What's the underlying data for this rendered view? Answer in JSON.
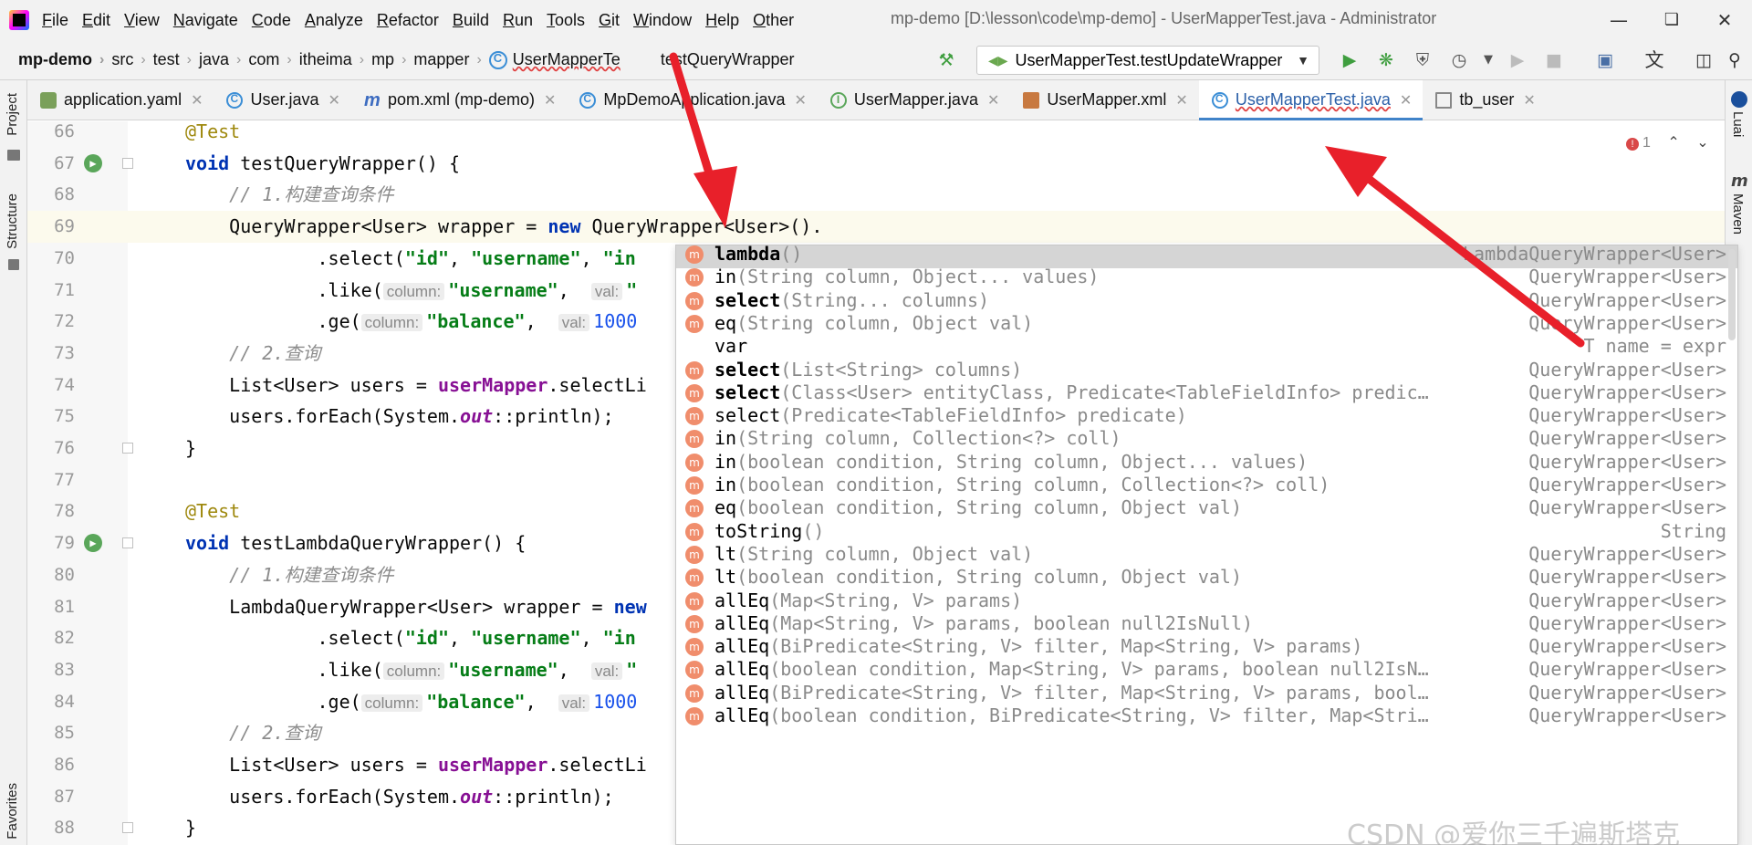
{
  "menu": {
    "items": [
      "File",
      "Edit",
      "View",
      "Navigate",
      "Code",
      "Analyze",
      "Refactor",
      "Build",
      "Run",
      "Tools",
      "Git",
      "Window",
      "Help",
      "Other"
    ],
    "title": "mp-demo [D:\\lesson\\code\\mp-demo] - UserMapperTest.java - Administrator"
  },
  "nav": {
    "crumbs": [
      "mp-demo",
      "src",
      "test",
      "java",
      "com",
      "itheima",
      "mp",
      "mapper",
      "UserMapperTe",
      "testQueryWrapper"
    ],
    "run_config": "UserMapperTest.testUpdateWrapper"
  },
  "tabs": [
    {
      "label": "application.yaml",
      "icon": "yaml-icon"
    },
    {
      "label": "User.java",
      "icon": "class-icon"
    },
    {
      "label": "pom.xml (mp-demo)",
      "icon": "maven-icon"
    },
    {
      "label": "MpDemoApplication.java",
      "icon": "class-icon"
    },
    {
      "label": "UserMapper.java",
      "icon": "interface-icon"
    },
    {
      "label": "UserMapper.xml",
      "icon": "xml-icon"
    },
    {
      "label": "UserMapperTest.java",
      "icon": "class-icon",
      "active": true
    },
    {
      "label": "tb_user",
      "icon": "table-icon"
    }
  ],
  "side": {
    "project": "Project",
    "structure": "Structure",
    "favorites": "Favorites",
    "right_top": "Luai",
    "maven": "Maven"
  },
  "editor": {
    "error_count": "1",
    "lines": [
      {
        "n": "66",
        "parts": [
          [
            "ann",
            "@Test"
          ]
        ]
      },
      {
        "n": "67",
        "gutter": true,
        "parts": [
          [
            "kw",
            "void"
          ],
          [
            "",
            " testQueryWrapper() {"
          ]
        ]
      },
      {
        "n": "68",
        "parts": [
          [
            "cm",
            "    // 1.构建查询条件"
          ]
        ]
      },
      {
        "n": "69",
        "cur": true,
        "parts": [
          [
            "",
            "    QueryWrapper<User> wrapper = "
          ],
          [
            "kw",
            "new"
          ],
          [
            "",
            " QueryWrapper<User>()."
          ]
        ]
      },
      {
        "n": "70",
        "parts": [
          [
            "",
            "            .select("
          ],
          [
            "st",
            "\"id\""
          ],
          [
            "",
            ", "
          ],
          [
            "st",
            "\"username\""
          ],
          [
            "",
            ", "
          ],
          [
            "st",
            "\"in"
          ]
        ]
      },
      {
        "n": "71",
        "parts": [
          [
            "",
            "            .like("
          ],
          [
            "hint",
            "column:"
          ],
          [
            "st",
            "\"username\""
          ],
          [
            "",
            ",  "
          ],
          [
            "hint",
            "val:"
          ],
          [
            "st",
            "\""
          ]
        ]
      },
      {
        "n": "72",
        "parts": [
          [
            "",
            "            .ge("
          ],
          [
            "hint",
            "column:"
          ],
          [
            "st",
            "\"balance\""
          ],
          [
            "",
            ",  "
          ],
          [
            "hint",
            "val:"
          ],
          [
            "num",
            "1000"
          ]
        ]
      },
      {
        "n": "73",
        "parts": [
          [
            "cm",
            "    // 2.查询"
          ]
        ]
      },
      {
        "n": "74",
        "parts": [
          [
            "",
            "    List<User> users = "
          ],
          [
            "fld",
            "userMapper"
          ],
          [
            "",
            ".selectLi"
          ]
        ]
      },
      {
        "n": "75",
        "parts": [
          [
            "",
            "    users.forEach(System."
          ],
          [
            "st-i",
            "out"
          ],
          [
            "",
            "::println);"
          ]
        ]
      },
      {
        "n": "76",
        "parts": [
          [
            "",
            "}"
          ]
        ]
      },
      {
        "n": "77",
        "parts": [
          [
            "",
            ""
          ]
        ]
      },
      {
        "n": "78",
        "parts": [
          [
            "ann",
            "@Test"
          ]
        ]
      },
      {
        "n": "79",
        "gutter": true,
        "parts": [
          [
            "kw",
            "void"
          ],
          [
            "",
            " testLambdaQueryWrapper() {"
          ]
        ]
      },
      {
        "n": "80",
        "parts": [
          [
            "cm",
            "    // 1.构建查询条件"
          ]
        ]
      },
      {
        "n": "81",
        "parts": [
          [
            "",
            "    LambdaQueryWrapper<User> wrapper = "
          ],
          [
            "kw",
            "new"
          ]
        ]
      },
      {
        "n": "82",
        "parts": [
          [
            "",
            "            .select("
          ],
          [
            "st",
            "\"id\""
          ],
          [
            "",
            ", "
          ],
          [
            "st",
            "\"username\""
          ],
          [
            "",
            ", "
          ],
          [
            "st",
            "\"in"
          ]
        ]
      },
      {
        "n": "83",
        "parts": [
          [
            "",
            "            .like("
          ],
          [
            "hint",
            "column:"
          ],
          [
            "st",
            "\"username\""
          ],
          [
            "",
            ",  "
          ],
          [
            "hint",
            "val:"
          ],
          [
            "st",
            "\""
          ]
        ]
      },
      {
        "n": "84",
        "parts": [
          [
            "",
            "            .ge("
          ],
          [
            "hint",
            "column:"
          ],
          [
            "st",
            "\"balance\""
          ],
          [
            "",
            ",  "
          ],
          [
            "hint",
            "val:"
          ],
          [
            "num",
            "1000"
          ]
        ]
      },
      {
        "n": "85",
        "parts": [
          [
            "cm",
            "    // 2.查询"
          ]
        ]
      },
      {
        "n": "86",
        "parts": [
          [
            "",
            "    List<User> users = "
          ],
          [
            "fld",
            "userMapper"
          ],
          [
            "",
            ".selectLi"
          ]
        ]
      },
      {
        "n": "87",
        "parts": [
          [
            "",
            "    users.forEach(System."
          ],
          [
            "st-i",
            "out"
          ],
          [
            "",
            "::println);"
          ]
        ]
      },
      {
        "n": "88",
        "parts": [
          [
            "",
            "}"
          ]
        ]
      }
    ]
  },
  "completion": {
    "items": [
      {
        "name": "lambda",
        "sig": "()",
        "ret": "LambdaQueryWrapper<User>",
        "bold": true,
        "selected": true,
        "icon": true
      },
      {
        "name": "in",
        "sig": "(String column, Object... values)",
        "ret": "QueryWrapper<User>",
        "icon": true
      },
      {
        "name": "select",
        "sig": "(String... columns)",
        "ret": "QueryWrapper<User>",
        "bold": true,
        "icon": true
      },
      {
        "name": "eq",
        "sig": "(String column, Object val)",
        "ret": "QueryWrapper<User>",
        "icon": true
      },
      {
        "name": "var",
        "sig": "",
        "ret": "T name = expr",
        "icon": false
      },
      {
        "name": "select",
        "sig": "(List<String> columns)",
        "ret": "QueryWrapper<User>",
        "bold": true,
        "icon": true
      },
      {
        "name": "select",
        "sig": "(Class<User> entityClass, Predicate<TableFieldInfo> predic…",
        "ret": "QueryWrapper<User>",
        "bold": true,
        "icon": true
      },
      {
        "name": "select",
        "sig": "(Predicate<TableFieldInfo> predicate)",
        "ret": "QueryWrapper<User>",
        "icon": true
      },
      {
        "name": "in",
        "sig": "(String column, Collection<?> coll)",
        "ret": "QueryWrapper<User>",
        "icon": true
      },
      {
        "name": "in",
        "sig": "(boolean condition, String column, Object... values)",
        "ret": "QueryWrapper<User>",
        "icon": true
      },
      {
        "name": "in",
        "sig": "(boolean condition, String column, Collection<?> coll)",
        "ret": "QueryWrapper<User>",
        "icon": true
      },
      {
        "name": "eq",
        "sig": "(boolean condition, String column, Object val)",
        "ret": "QueryWrapper<User>",
        "icon": true
      },
      {
        "name": "toString",
        "sig": "()",
        "ret": "String",
        "icon": true
      },
      {
        "name": "lt",
        "sig": "(String column, Object val)",
        "ret": "QueryWrapper<User>",
        "icon": true
      },
      {
        "name": "lt",
        "sig": "(boolean condition, String column, Object val)",
        "ret": "QueryWrapper<User>",
        "icon": true
      },
      {
        "name": "allEq",
        "sig": "(Map<String, V> params)",
        "ret": "QueryWrapper<User>",
        "icon": true
      },
      {
        "name": "allEq",
        "sig": "(Map<String, V> params, boolean null2IsNull)",
        "ret": "QueryWrapper<User>",
        "icon": true
      },
      {
        "name": "allEq",
        "sig": "(BiPredicate<String, V> filter, Map<String, V> params)",
        "ret": "QueryWrapper<User>",
        "icon": true
      },
      {
        "name": "allEq",
        "sig": "(boolean condition, Map<String, V> params, boolean null2IsN…",
        "ret": "QueryWrapper<User>",
        "icon": true
      },
      {
        "name": "allEq",
        "sig": "(BiPredicate<String, V> filter, Map<String, V> params, bool…",
        "ret": "QueryWrapper<User>",
        "icon": true
      },
      {
        "name": "allEq",
        "sig": "(boolean condition, BiPredicate<String, V> filter, Map<Stri…",
        "ret": "QueryWrapper<User>",
        "icon": true
      }
    ]
  },
  "watermark": "CSDN @爱你三千遍斯塔克",
  "colors": {
    "accent": "#4083c9",
    "annotation_arrow": "#e8202a"
  }
}
